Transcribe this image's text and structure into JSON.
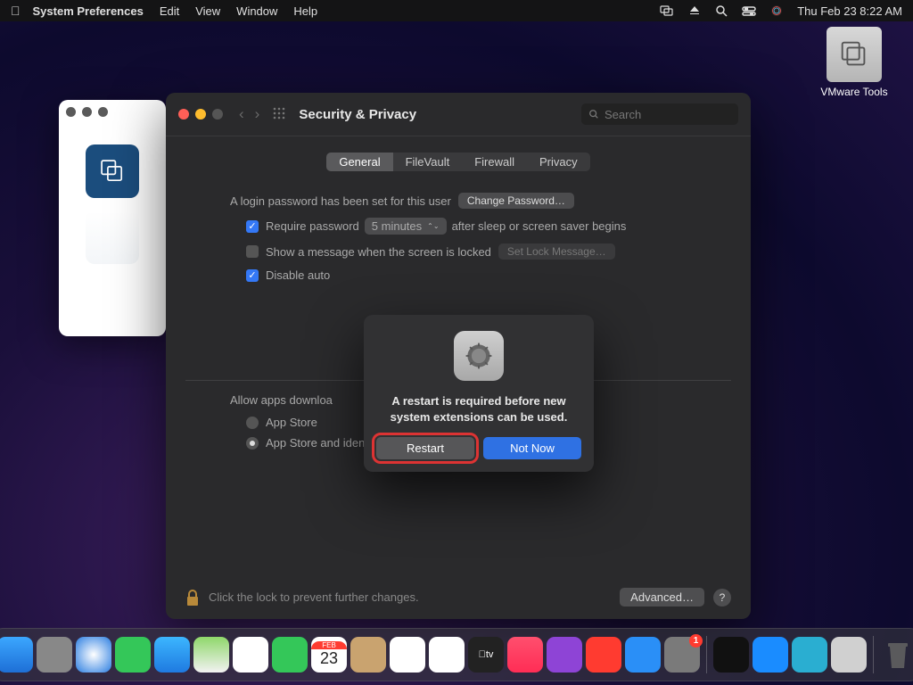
{
  "menubar": {
    "app": "System Preferences",
    "items": [
      "Edit",
      "View",
      "Window",
      "Help"
    ],
    "datetime": "Thu Feb 23  8:22 AM"
  },
  "desktop": {
    "icon_label": "VMware Tools"
  },
  "pref": {
    "title": "Security & Privacy",
    "search_placeholder": "Search",
    "tabs": [
      "General",
      "FileVault",
      "Firewall",
      "Privacy"
    ],
    "login": {
      "password_set": "A login password has been set for this user",
      "change_password": "Change Password…",
      "require_password": "Require password",
      "delay": "5 minutes",
      "after_sleep": "after sleep or screen saver begins",
      "show_message": "Show a message when the screen is locked",
      "set_lock_message": "Set Lock Message…",
      "disable_auto": "Disable auto"
    },
    "allow": {
      "label": "Allow apps downloa",
      "options": [
        "App Store",
        "App Store and identified developers"
      ]
    },
    "footer": {
      "lock_msg": "Click the lock to prevent further changes.",
      "advanced": "Advanced…"
    }
  },
  "dialog": {
    "message": "A restart is required before new system extensions can be used.",
    "restart": "Restart",
    "not_now": "Not Now"
  },
  "dock": {
    "cal_month": "FEB",
    "cal_day": "23",
    "pref_badge": "1"
  }
}
